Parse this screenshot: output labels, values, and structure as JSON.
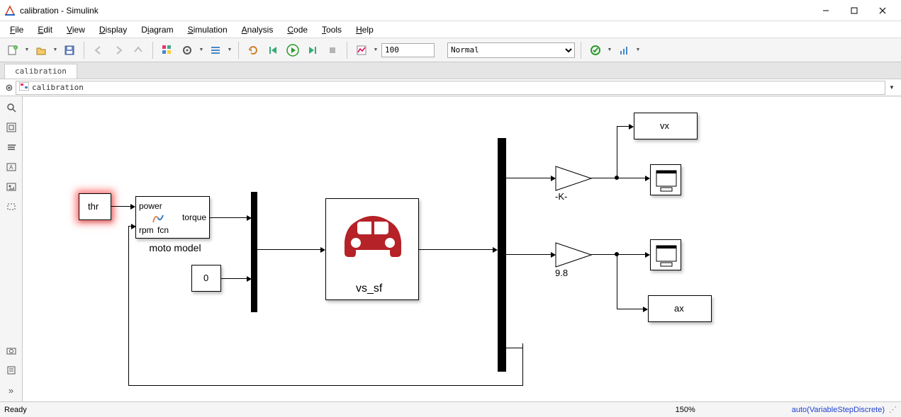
{
  "window": {
    "title": "calibration - Simulink"
  },
  "menu": {
    "file": "File",
    "edit": "Edit",
    "view": "View",
    "display": "Display",
    "diagram": "Diagram",
    "simulation": "Simulation",
    "analysis": "Analysis",
    "code": "Code",
    "tools": "Tools",
    "help": "Help"
  },
  "toolbar": {
    "stop_time": "100",
    "sim_mode": "Normal"
  },
  "tab": {
    "name": "calibration"
  },
  "breadcrumb": {
    "model": "calibration"
  },
  "blocks": {
    "thr": "thr",
    "fcn_in1": "power",
    "fcn_in2": "rpm",
    "fcn_out": "torque",
    "fcn_name": "fcn",
    "fcn_sub": "moto model",
    "const0": "0",
    "vssf": "vs_sf",
    "gainK": "-K-",
    "gain98": "9.8",
    "toWs_vx": "vx",
    "toWs_ax": "ax"
  },
  "status": {
    "left": "Ready",
    "zoom": "150%",
    "solver": "auto(VariableStepDiscrete)"
  }
}
